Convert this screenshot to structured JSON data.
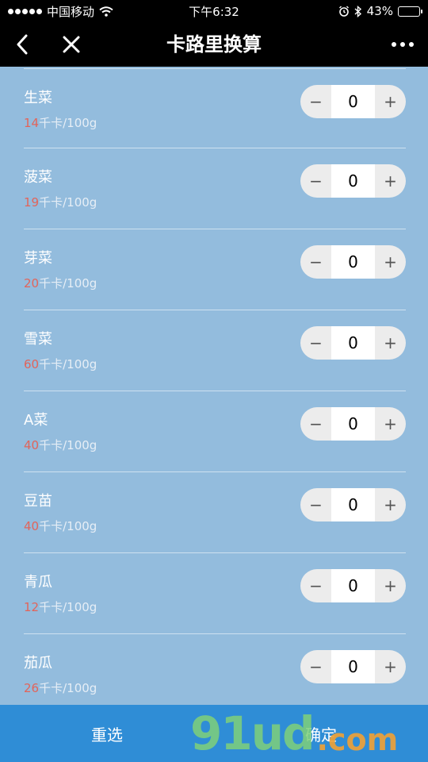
{
  "status_bar": {
    "carrier": "中国移动",
    "time": "下午6:32",
    "battery": "43%"
  },
  "nav": {
    "title": "卡路里换算"
  },
  "unit_suffix": "千卡/100g",
  "items": [
    {
      "name": "生菜",
      "calories": "14",
      "qty": "0"
    },
    {
      "name": "菠菜",
      "calories": "19",
      "qty": "0"
    },
    {
      "name": "芽菜",
      "calories": "20",
      "qty": "0"
    },
    {
      "name": "雪菜",
      "calories": "60",
      "qty": "0"
    },
    {
      "name": "A菜",
      "calories": "40",
      "qty": "0"
    },
    {
      "name": "豆苗",
      "calories": "40",
      "qty": "0"
    },
    {
      "name": "青瓜",
      "calories": "12",
      "qty": "0"
    },
    {
      "name": "茄瓜",
      "calories": "26",
      "qty": "0"
    }
  ],
  "stepper": {
    "minus": "−",
    "plus": "+"
  },
  "bottom": {
    "reset_label": "重选",
    "confirm_label": "确定"
  },
  "watermark": {
    "main": "91ud",
    "suffix": ".com"
  }
}
